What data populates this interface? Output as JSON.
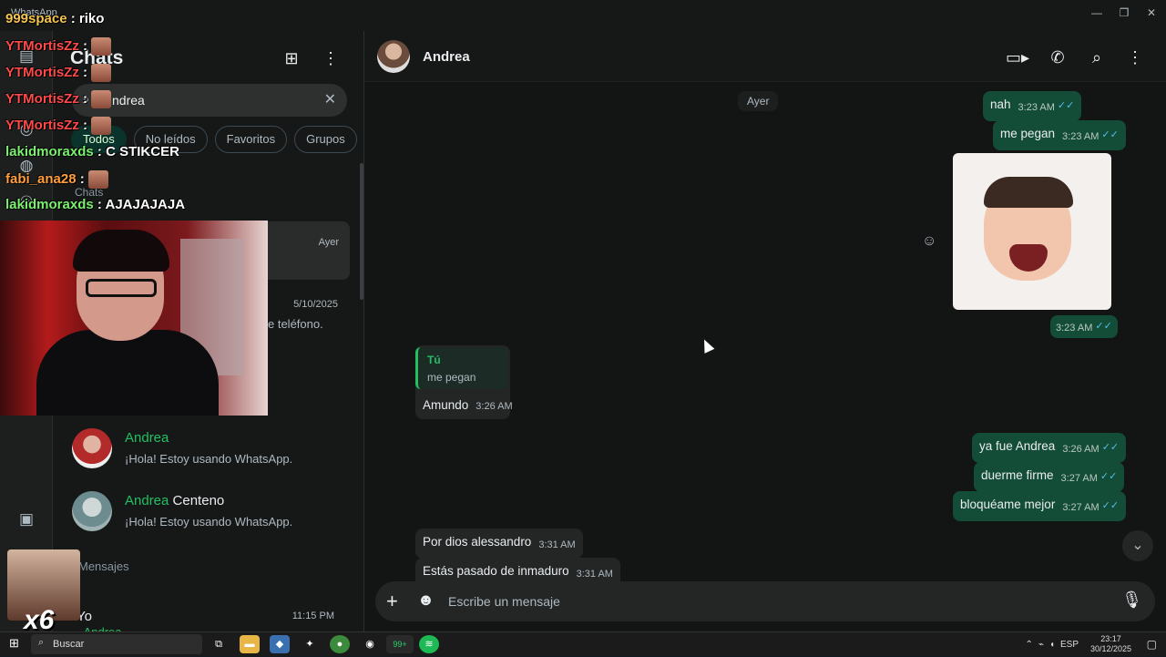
{
  "window": {
    "title": "WhatsApp",
    "min": "—",
    "max": "❐",
    "close": "✕"
  },
  "sidebar": {
    "title": "Chats",
    "search": {
      "value": "ndrea",
      "placeholder": "Buscar"
    },
    "chips": [
      "Todos",
      "No leídos",
      "Favoritos",
      "Grupos"
    ],
    "section_chats": "Chats",
    "selected_time": "Ayer",
    "row2_date": "5/10/2025",
    "row2_sub": "e teléfono.",
    "contacts": [
      {
        "name_hl": "Andrea",
        "name_rest": "",
        "status": "¡Hola! Estoy usando WhatsApp."
      },
      {
        "name_hl": "Andrea",
        "name_rest": " Centeno",
        "status": "¡Hola! Estoy usando WhatsApp."
      }
    ],
    "section_messages": "Mensajes",
    "msg_row": {
      "name": "Yo",
      "time": "11:15 PM",
      "sub": "~Andrea"
    }
  },
  "chat": {
    "contact": "Andrea",
    "day": "Ayer",
    "outgoing": [
      {
        "text": "nah",
        "time": "3:23 AM"
      },
      {
        "text": "me pegan",
        "time": "3:23 AM"
      },
      {
        "text": "",
        "time": "3:23 AM"
      },
      {
        "text": "ya fue Andrea",
        "time": "3:26 AM"
      },
      {
        "text": "duerme firme",
        "time": "3:27 AM"
      },
      {
        "text": "bloquéame mejor",
        "time": "3:27 AM"
      }
    ],
    "reply": {
      "author": "Tú",
      "quoted": "me pegan",
      "text": "Amundo",
      "time": "3:26 AM"
    },
    "incoming": [
      {
        "text": "Por dios alessandro",
        "time": "3:31 AM"
      },
      {
        "text": "Estás pasado de inmaduro",
        "time": "3:31 AM"
      }
    ],
    "composer_placeholder": "Escribe un mensaje",
    "ticks": "✓✓"
  },
  "overlay": {
    "lines": [
      {
        "user": "999space",
        "sep": " : ",
        "text": "riko",
        "color": "yellow"
      },
      {
        "user": "YTMortisZz",
        "sep": " : ",
        "text": "",
        "color": "red"
      },
      {
        "user": "YTMortisZz",
        "sep": " : ",
        "text": "",
        "color": "red"
      },
      {
        "user": "YTMortisZz",
        "sep": " : ",
        "text": "",
        "color": "red"
      },
      {
        "user": "YTMortisZz",
        "sep": " : ",
        "text": "",
        "color": "red"
      },
      {
        "user": "lakidmoraxds",
        "sep": " : ",
        "text": "C STIKCER",
        "color": "green"
      },
      {
        "user": "fabi_ana28",
        "sep": " : ",
        "text": "",
        "color": "orange"
      },
      {
        "user": "lakidmoraxds",
        "sep": " : ",
        "text": "AJAJAJAJA",
        "color": "green"
      }
    ],
    "multiplier": "x6"
  },
  "taskbar": {
    "search": "Buscar",
    "lang": "ESP",
    "time": "23:17",
    "date": "30/12/2025",
    "wa_badge": "99+"
  }
}
